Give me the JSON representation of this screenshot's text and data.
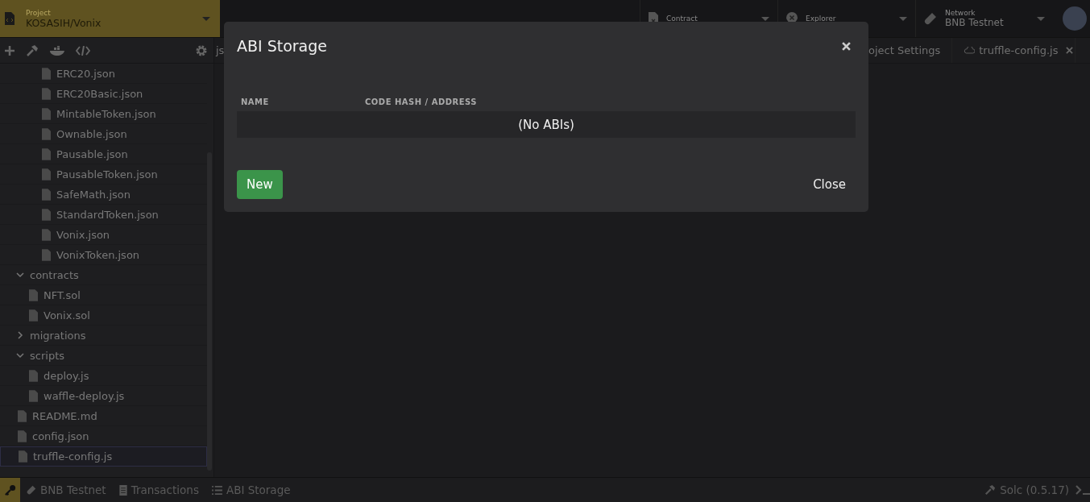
{
  "project": {
    "label": "Project",
    "value": "KOSASIH/Vonix"
  },
  "top_selectors": [
    {
      "kind": "contract",
      "label": "Contract"
    },
    {
      "kind": "explorer",
      "label": "Explorer"
    },
    {
      "kind": "network",
      "label": "Network",
      "value": "BNB Testnet"
    }
  ],
  "tabs": [
    {
      "kind": "plain",
      "label": "js"
    },
    {
      "kind": "plain",
      "label": "oject Settings"
    },
    {
      "kind": "cloud",
      "label": "truffle-config.js"
    }
  ],
  "scrolled_files": [
    {
      "label": "ERC20.json"
    },
    {
      "label": "ERC20Basic.json"
    },
    {
      "label": "MintableToken.json"
    },
    {
      "label": "Ownable.json"
    },
    {
      "label": "Pausable.json"
    },
    {
      "label": "PausableToken.json"
    },
    {
      "label": "SafeMath.json"
    },
    {
      "label": "StandardToken.json"
    },
    {
      "label": "Vonix.json"
    },
    {
      "label": "VonixToken.json"
    }
  ],
  "tree": [
    {
      "kind": "folder",
      "label": "contracts",
      "expanded": true,
      "selected": false,
      "children": [
        {
          "label": "NFT.sol",
          "selected": false
        },
        {
          "label": "Vonix.sol",
          "selected": false
        }
      ]
    },
    {
      "kind": "folder",
      "label": "migrations",
      "expanded": false,
      "selected": false
    },
    {
      "kind": "folder",
      "label": "scripts",
      "expanded": true,
      "selected": false,
      "children": [
        {
          "label": "deploy.js",
          "selected": false
        },
        {
          "label": "waffle-deploy.js",
          "selected": false
        }
      ]
    },
    {
      "label": "README.md",
      "selected": false
    },
    {
      "label": "config.json",
      "selected": false
    },
    {
      "label": "truffle-config.js",
      "selected": true
    }
  ],
  "dialog": {
    "title": "ABI Storage",
    "columns": [
      "NAME",
      "CODE HASH / ADDRESS"
    ],
    "empty_text": "(No ABIs)",
    "buttons": [
      {
        "kind": "primary",
        "label": "New"
      },
      {
        "kind": "plain",
        "label": "Close"
      }
    ]
  },
  "status_bar": {
    "left": [
      {
        "kind": "network",
        "label": "BNB Testnet"
      },
      {
        "kind": "transactions",
        "label": "Transactions"
      },
      {
        "kind": "list",
        "label": "ABI Storage"
      }
    ],
    "right": [
      {
        "kind": "compiler",
        "label": "Solc (0.5.17)"
      }
    ]
  }
}
